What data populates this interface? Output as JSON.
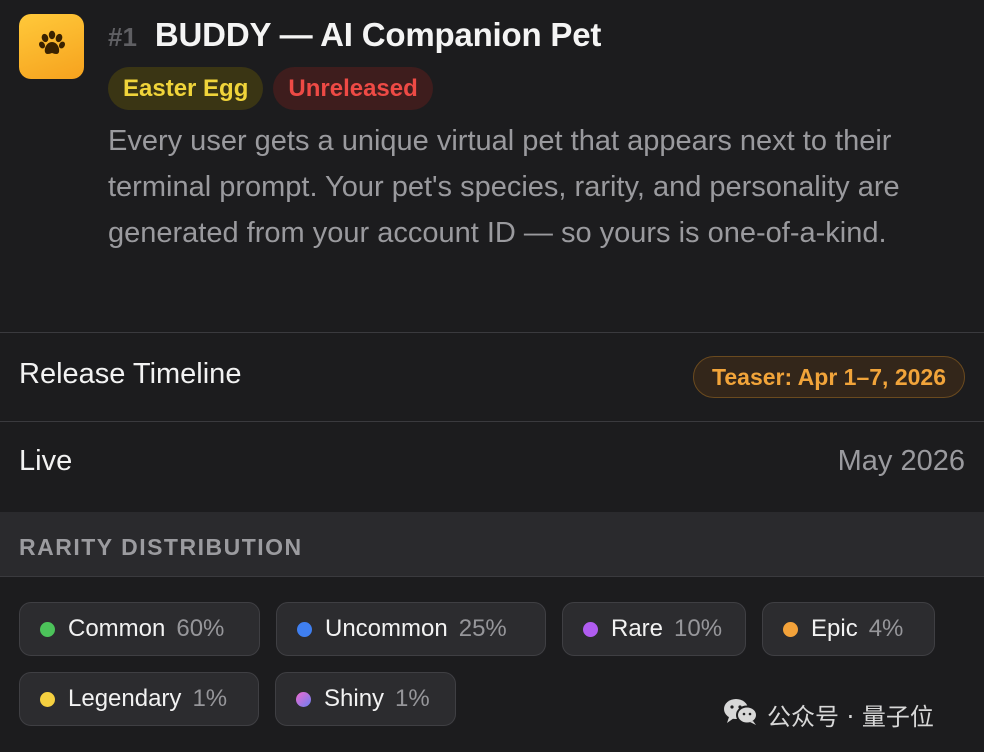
{
  "feature": {
    "rank": "#1",
    "title": "BUDDY — AI Companion Pet",
    "icon": "paw-icon",
    "badges": {
      "easter_egg": "Easter Egg",
      "unreleased": "Unreleased"
    },
    "description": "Every user gets a unique virtual pet that appears next to their terminal prompt. Your pet's species, rarity, and personality are generated from your account ID — so yours is one-of-a-kind."
  },
  "timeline": {
    "release_label": "Release Timeline",
    "release_value": "Teaser: Apr 1–7, 2026",
    "live_label": "Live",
    "live_value": "May 2026"
  },
  "rarity": {
    "section_title": "RARITY DISTRIBUTION",
    "items": [
      {
        "name": "Common",
        "pct": "60%",
        "color": "#4cc35a"
      },
      {
        "name": "Uncommon",
        "pct": "25%",
        "color": "#3f7ff0"
      },
      {
        "name": "Rare",
        "pct": "10%",
        "color": "#b05cf0"
      },
      {
        "name": "Epic",
        "pct": "4%",
        "color": "#f3a23a"
      },
      {
        "name": "Legendary",
        "pct": "1%",
        "color": "#f5d040"
      },
      {
        "name": "Shiny",
        "pct": "1%",
        "color": "gradient"
      }
    ]
  },
  "watermark": {
    "text": "公众号 · 量子位",
    "icon": "wechat-icon"
  },
  "colors": {
    "background": "#1c1c1e",
    "accent_orange": "#f1a43a",
    "easter_egg_yellow": "#f0d43a",
    "unreleased_red": "#ee4a45"
  }
}
